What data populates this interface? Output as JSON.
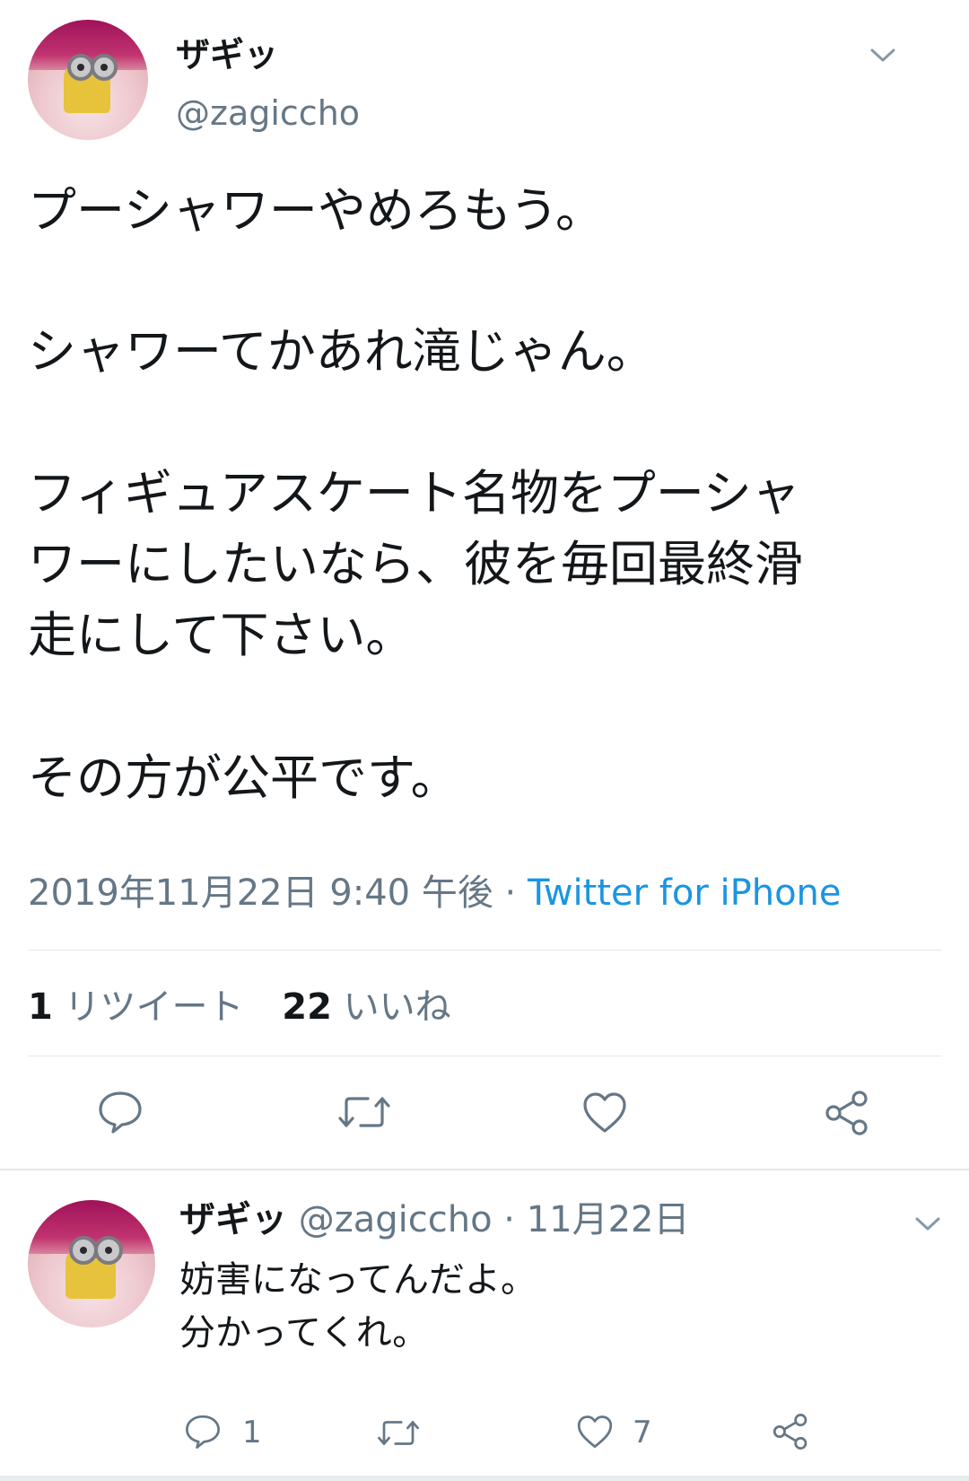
{
  "main_tweet": {
    "display_name": "ザギッ",
    "handle": "@zagiccho",
    "text_lines": [
      "プーシャワーやめろもう。",
      "シャワーてかあれ滝じゃん。",
      "フィギュアスケート名物をプーシャ",
      "ワーにしたいなら、彼を毎回最終滑",
      "走にして下さい。",
      "その方が公平です。"
    ],
    "timestamp": "2019年11月22日 9:40 午後 · ",
    "source": "Twitter for iPhone",
    "retweet_count": "1",
    "retweet_label": "リツイート",
    "like_count": "22",
    "like_label": "いいね"
  },
  "reply_tweet": {
    "display_name": "ザギッ",
    "handle": "@zagiccho",
    "date": " · 11月22日",
    "text_lines": [
      "妨害になってんだよ。",
      "分かってくれ。"
    ],
    "reply_count": "1",
    "like_count": "7"
  },
  "icons": [
    "chevron-down-icon",
    "reply-icon",
    "retweet-icon",
    "like-icon",
    "share-icon"
  ],
  "colors": {
    "link": "#1b95e0",
    "text": "#14171a",
    "muted": "#657786",
    "divider": "#e1e8ed"
  }
}
